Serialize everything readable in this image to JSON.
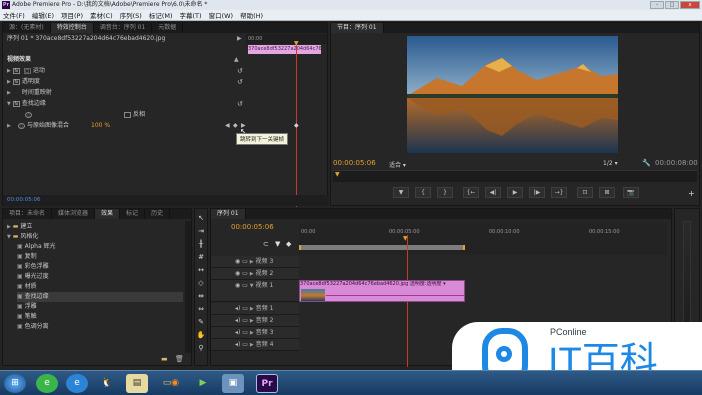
{
  "app": {
    "title": "Adobe Premiere Pro - D:\\我的文档\\Adobe\\Premiere Pro\\6.0\\未命名 *",
    "icon_label": "Pr"
  },
  "window_controls": {
    "minimize": "-",
    "maximize": "□",
    "close": "x"
  },
  "menu": [
    "文件(F)",
    "编辑(E)",
    "项目(P)",
    "素材(C)",
    "序列(S)",
    "标记(M)",
    "字幕(T)",
    "窗口(W)",
    "帮助(H)"
  ],
  "effect_controls": {
    "tabs": [
      "源：(无素材)",
      "特效控制台",
      "调音台：序列 01",
      "元数据"
    ],
    "active_tab": 1,
    "clip_label": "序列 01 * 370ace8df53227a204d64c76ebad4620.jpg",
    "ruler_time": "00:00",
    "mini_clip_label": "370ace8df53227a204d64c76...",
    "section_video": "视频效果",
    "rows": [
      {
        "name": "运动",
        "has_fx": true,
        "has_reset": true
      },
      {
        "name": "透明度",
        "has_fx": true,
        "has_reset": true
      },
      {
        "name": "时间重映射",
        "has_fx": false,
        "has_reset": false
      },
      {
        "name": "查找边缘",
        "has_fx": true,
        "has_reset": true
      }
    ],
    "invert_label": "反相",
    "blend_label": "与原始图像混合",
    "blend_value": "100 %",
    "tooltip": "跳转到下一关键帧",
    "timecode": "00:00:05:06"
  },
  "program": {
    "tab": "节目：序列 01",
    "timecode_left": "00:00:05:06",
    "fit_label": "适合",
    "ratio_label": "1/2",
    "timecode_right": "00:00:08:00",
    "transport": [
      "▼",
      "{",
      "}",
      "{←",
      "◀|",
      "▶",
      "|▶",
      "→}",
      "⊡",
      "⊠",
      "📷"
    ]
  },
  "project": {
    "tabs": [
      "项目：未命名",
      "媒体浏览器",
      "效果",
      "标记",
      "历史"
    ],
    "active_tab": 2,
    "items": [
      {
        "label": "建立",
        "type": "folder",
        "indent": 1
      },
      {
        "label": "风格化",
        "type": "folder",
        "indent": 1,
        "open": true
      },
      {
        "label": "Alpha 辉光",
        "type": "effect",
        "indent": 2
      },
      {
        "label": "复制",
        "type": "effect",
        "indent": 2
      },
      {
        "label": "彩色浮雕",
        "type": "effect",
        "indent": 2
      },
      {
        "label": "曝光过度",
        "type": "effect",
        "indent": 2
      },
      {
        "label": "材质",
        "type": "effect",
        "indent": 2
      },
      {
        "label": "查找边缘",
        "type": "effect",
        "indent": 2,
        "selected": true
      },
      {
        "label": "浮雕",
        "type": "effect",
        "indent": 2
      },
      {
        "label": "笔触",
        "type": "effect",
        "indent": 2
      },
      {
        "label": "色调分离",
        "type": "effect",
        "indent": 2
      }
    ]
  },
  "timeline": {
    "tab": "序列 01",
    "timecode": "00:00:05:06",
    "ruler_labels": [
      "00:00",
      "00:00:05:00",
      "00:00:10:00",
      "00:00:15:00"
    ],
    "tracks": [
      {
        "name": "视频 3",
        "kind": "video"
      },
      {
        "name": "视频 2",
        "kind": "video"
      },
      {
        "name": "视频 1",
        "kind": "video",
        "expanded": true
      },
      {
        "name": "音频 1",
        "kind": "audio"
      },
      {
        "name": "音频 2",
        "kind": "audio"
      },
      {
        "name": "音频 3",
        "kind": "audio"
      },
      {
        "name": "音频 4",
        "kind": "audio"
      }
    ],
    "clip_label": "370ace8df53227a204d64c76ebad4620.jpg 透明度:透明度 ▾",
    "clip_color": "#d98ad6"
  },
  "watermark": {
    "brand": "PConline",
    "name": "IT百科"
  },
  "taskbar": {
    "icons": [
      {
        "name": "start",
        "glyph": "⊞"
      },
      {
        "name": "browser-360",
        "glyph": "e"
      },
      {
        "name": "ie",
        "glyph": "e"
      },
      {
        "name": "qq",
        "glyph": "🐧"
      },
      {
        "name": "explorer",
        "glyph": "▤"
      },
      {
        "name": "folder",
        "glyph": "▭"
      },
      {
        "name": "firefox",
        "glyph": "◉"
      },
      {
        "name": "media-player",
        "glyph": "▶"
      },
      {
        "name": "window",
        "glyph": "▣"
      },
      {
        "name": "premiere",
        "glyph": "Pr"
      }
    ]
  },
  "colors": {
    "accent": "#e0a234",
    "playhead": "#c9392c",
    "clip": "#d98ad6",
    "selection": "#3a5f8a"
  }
}
